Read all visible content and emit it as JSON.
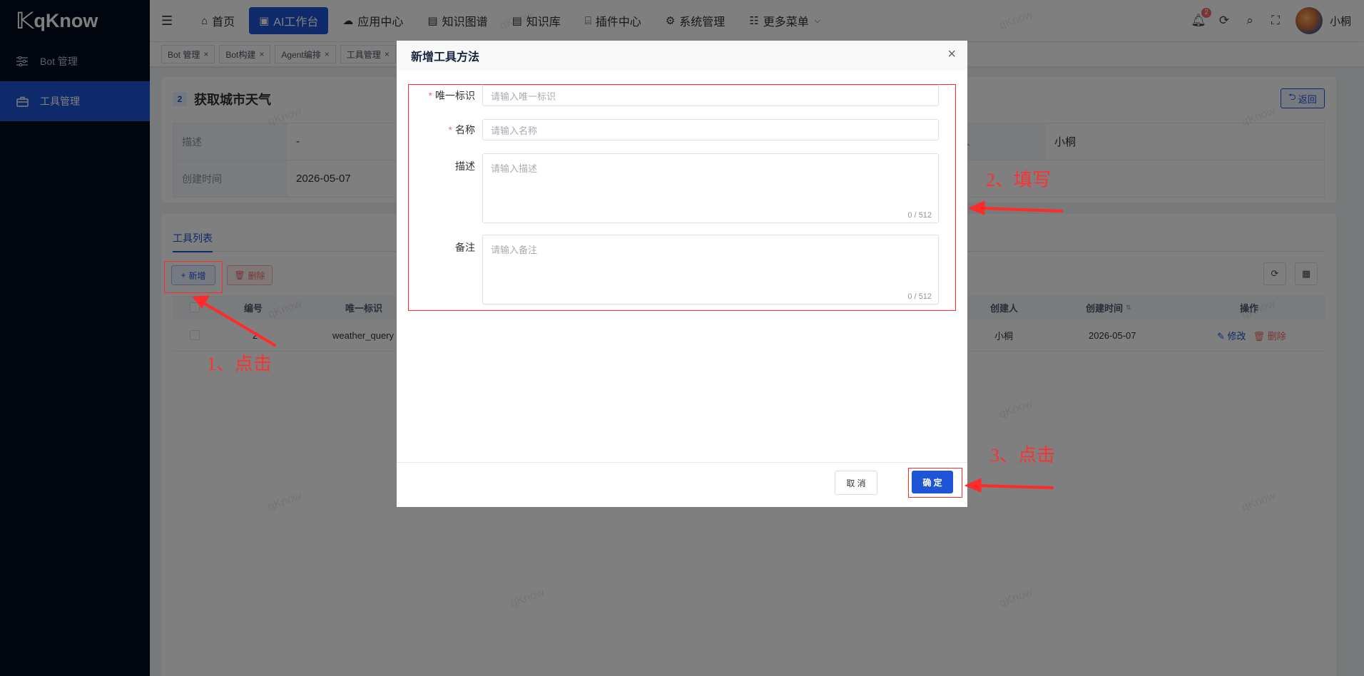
{
  "app": {
    "logo_text": "qKnow"
  },
  "sidebar": {
    "items": [
      {
        "label": "Bot 管理"
      },
      {
        "label": "工具管理"
      }
    ]
  },
  "topnav": {
    "items": [
      {
        "label": "首页"
      },
      {
        "label": "AI工作台"
      },
      {
        "label": "应用中心"
      },
      {
        "label": "知识图谱"
      },
      {
        "label": "知识库"
      },
      {
        "label": "插件中心"
      },
      {
        "label": "系统管理"
      },
      {
        "label": "更多菜单"
      }
    ],
    "badge_count": "2",
    "username": "小桐"
  },
  "tags": [
    {
      "label": "Bot 管理"
    },
    {
      "label": "Bot构建"
    },
    {
      "label": "Agent编排"
    },
    {
      "label": "工具管理"
    }
  ],
  "detail": {
    "index": "2",
    "title": "获取城市天气",
    "back_label": "返回",
    "rows": {
      "desc_label": "描述",
      "desc_value": "-",
      "creator_label": "创建人",
      "creator_value": "小桐",
      "created_label": "创建时间",
      "created_value": "2026-05-07"
    }
  },
  "tool_list": {
    "tab_label": "工具列表",
    "add_label": "新增",
    "delete_label": "删除",
    "columns": {
      "id": "编号",
      "unique_id": "唯一标识",
      "creator": "创建人",
      "created": "创建时间",
      "action": "操作"
    },
    "row": {
      "id": "2",
      "unique_id": "weather_query",
      "creator": "小桐",
      "created": "2026-05-07",
      "edit": "修改",
      "delete": "删除"
    }
  },
  "dialog": {
    "title": "新增工具方法",
    "fields": {
      "unique_id_label": "唯一标识",
      "unique_id_placeholder": "请输入唯一标识",
      "name_label": "名称",
      "name_placeholder": "请输入名称",
      "desc_label": "描述",
      "desc_placeholder": "请输入描述",
      "desc_counter": "0 / 512",
      "remark_label": "备注",
      "remark_placeholder": "请输入备注",
      "remark_counter": "0 / 512"
    },
    "cancel_label": "取 消",
    "ok_label": "确 定"
  },
  "annotations": {
    "step1": "1、点击",
    "step2": "2、填写",
    "step3": "3、点击"
  },
  "watermark": "qKnow",
  "colors": {
    "primary": "#1e55d6",
    "sidebar_bg": "#030c1c",
    "annotation_red": "#ff2a2a"
  }
}
